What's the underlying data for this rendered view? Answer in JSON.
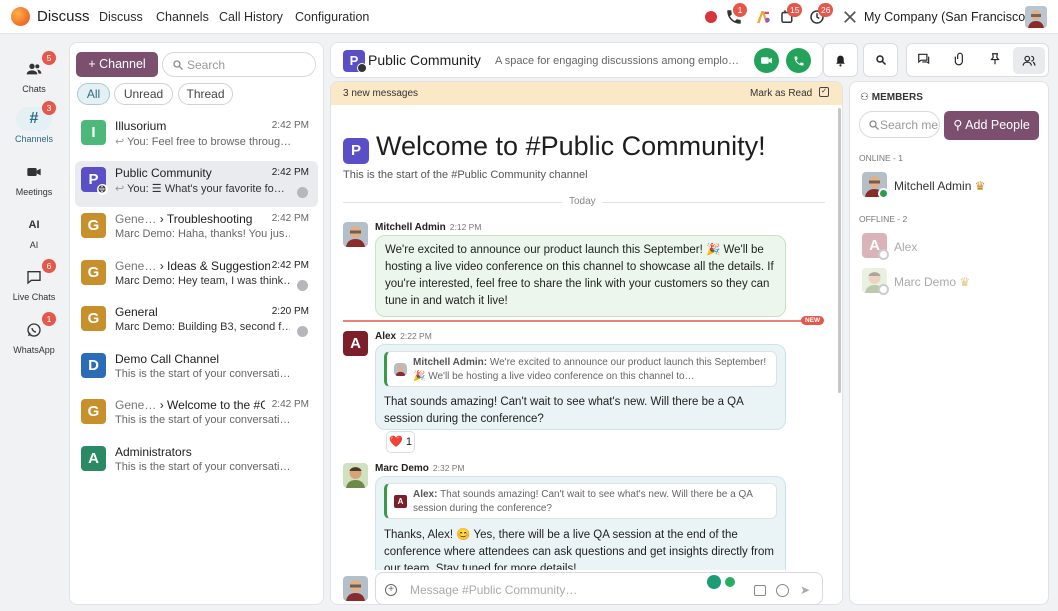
{
  "app": {
    "name": "Discuss"
  },
  "top_menu": [
    "Discuss",
    "Channels",
    "Call History",
    "Configuration"
  ],
  "top_icons": {
    "record": "record-icon",
    "phone_badge": "1",
    "activity_badge": "15",
    "clock_badge": "26"
  },
  "company": "My Company (San Francisco)",
  "rail": [
    {
      "label": "Chats",
      "badge": "5"
    },
    {
      "label": "Channels",
      "badge": "3"
    },
    {
      "label": "Meetings",
      "badge": ""
    },
    {
      "label": "AI",
      "badge": ""
    },
    {
      "label": "Live Chats",
      "badge": "6"
    },
    {
      "label": "WhatsApp",
      "badge": "1"
    }
  ],
  "sidebar": {
    "add_channel": "Channel",
    "search_placeholder": "Search",
    "filters": [
      "All",
      "Unread",
      "Thread"
    ],
    "channels": [
      {
        "letter": "I",
        "name": "Illusorium",
        "time": "2:42 PM",
        "preview": "You: Feel free to browse throug…",
        "color": "#4cb97a"
      },
      {
        "letter": "P",
        "name": "Public Community",
        "time": "2:42 PM",
        "preview": "What's your favorite fo…",
        "color": "#5b4fc8"
      },
      {
        "letter": "G",
        "parent": "Gene…",
        "name": "Troubleshooting",
        "time": "2:42 PM",
        "preview": "Marc Demo: Haha, thanks! You jus…",
        "color": "#c7902a"
      },
      {
        "letter": "G",
        "parent": "Gene…",
        "name": "Ideas & Suggestion",
        "time": "2:42 PM",
        "preview": "Marc Demo: Hey team, I was think…",
        "color": "#c7902a"
      },
      {
        "letter": "G",
        "name": "General",
        "time": "2:20 PM",
        "preview": "Marc Demo: Building B3, second f…",
        "color": "#c7902a"
      },
      {
        "letter": "D",
        "name": "Demo Call Channel",
        "time": "",
        "preview": "This is the start of your conversati…",
        "color": "#2a6cb5"
      },
      {
        "letter": "G",
        "parent": "Gene…",
        "name": "Welcome to the #Ge",
        "time": "2:42 PM",
        "preview": "This is the start of your conversati…",
        "color": "#c7902a"
      },
      {
        "letter": "A",
        "name": "Administrators",
        "time": "",
        "preview": "This is the start of your conversati…",
        "color": "#2a8a64"
      }
    ],
    "you_prefix": "You:"
  },
  "thread": {
    "avatar_letter": "P",
    "title": "Public Community",
    "description": "A space for engaging discussions among emplo…",
    "new_messages": "3 new messages",
    "mark_read": "Mark as Read",
    "welcome": "Welcome to #Public Community!",
    "start_note": "This is the start of the #Public Community channel",
    "today": "Today",
    "new_tag": "NEW",
    "composer_placeholder": "Message #Public Community…",
    "messages": [
      {
        "author": "Mitchell Admin",
        "time": "2:12 PM",
        "text": "We're excited to announce our product launch this September! 🎉 We'll be hosting a live video conference on this channel to showcase all the details. If you're interested, feel free to share the link with your customers so they can tune in and watch it live!"
      },
      {
        "author": "Alex",
        "time": "2:22 PM",
        "quote_author": "Mitchell Admin:",
        "quote": "We're excited to announce our product launch this September! 🎉 We'll be hosting a live video conference on this channel to…",
        "text": "That sounds amazing! Can't wait to see what's new. Will there be a QA session during the conference?",
        "reaction": "❤️",
        "reaction_count": "1"
      },
      {
        "author": "Marc Demo",
        "time": "2:32 PM",
        "quote_author": "Alex:",
        "quote": "That sounds amazing! Can't wait to see what's new. Will there be a QA session during the conference?",
        "text": "Thanks, Alex! 😊 Yes, there will be a live QA session at the end of the conference where attendees can ask questions and get insights directly from our team. Stay tuned for more details!"
      }
    ]
  },
  "members": {
    "title": "MEMBERS",
    "search_placeholder": "Search me",
    "add_people": "Add People",
    "online_label": "ONLINE - 1",
    "offline_label": "OFFLINE - 2",
    "online": [
      {
        "name": "Mitchell Admin"
      }
    ],
    "offline": [
      {
        "name": "Alex",
        "letter": "A"
      },
      {
        "name": "Marc Demo"
      }
    ]
  }
}
